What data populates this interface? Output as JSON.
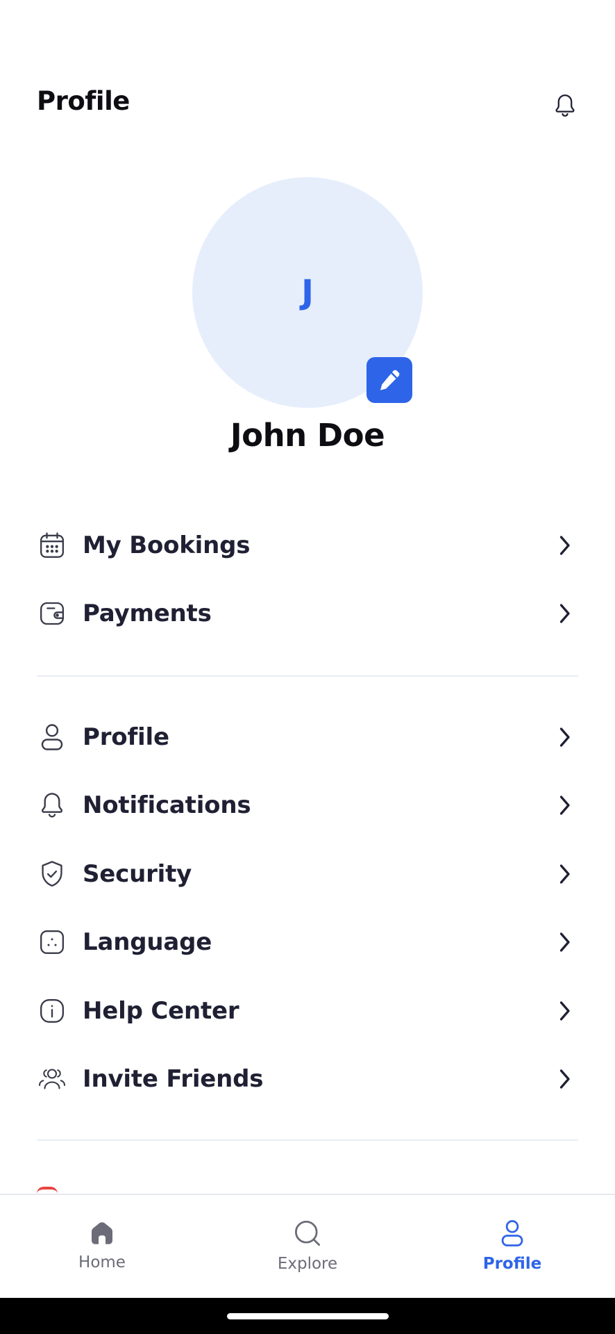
{
  "header": {
    "title": "Profile"
  },
  "profile": {
    "initial": "J",
    "name": "John Doe"
  },
  "menu_group_1": [
    {
      "label": "My Bookings",
      "icon": "calendar-icon"
    },
    {
      "label": "Payments",
      "icon": "wallet-icon"
    }
  ],
  "menu_group_2": [
    {
      "label": "Profile",
      "icon": "user-icon"
    },
    {
      "label": "Notifications",
      "icon": "bell-icon"
    },
    {
      "label": "Security",
      "icon": "shield-check-icon"
    },
    {
      "label": "Language",
      "icon": "language-icon"
    },
    {
      "label": "Help Center",
      "icon": "info-icon"
    },
    {
      "label": "Invite Friends",
      "icon": "users-icon"
    }
  ],
  "bottom_nav": {
    "items": [
      {
        "label": "Home",
        "icon": "home-icon",
        "active": false
      },
      {
        "label": "Explore",
        "icon": "search-icon",
        "active": false
      },
      {
        "label": "Profile",
        "icon": "user-icon",
        "active": true
      }
    ]
  },
  "colors": {
    "accent": "#2e64e8",
    "avatar_bg": "#e6eefc",
    "text_primary": "#1f2033",
    "divider": "#e8edf5",
    "nav_inactive": "#6b6c78",
    "logout_peek": "#e8433f"
  }
}
